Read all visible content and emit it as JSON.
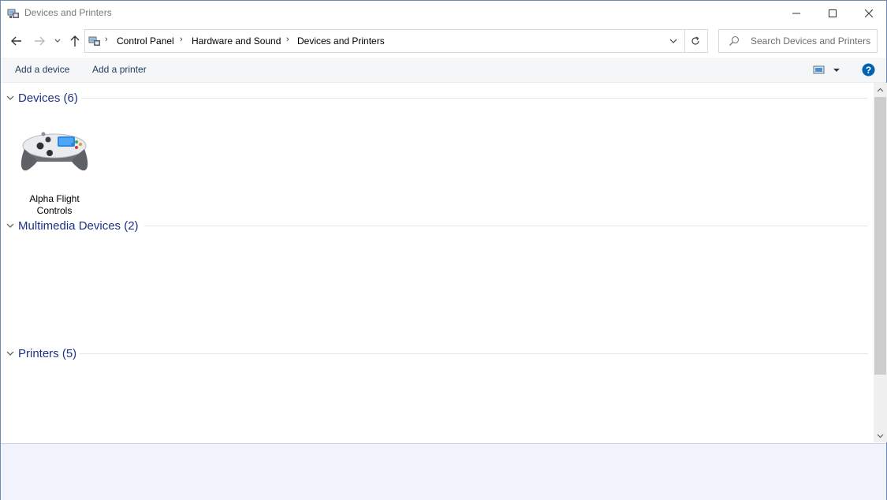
{
  "window": {
    "title": "Devices and Printers",
    "buttons": [
      "minimize",
      "maximize",
      "close"
    ]
  },
  "nav": {
    "breadcrumb": [
      "Control Panel",
      "Hardware and Sound",
      "Devices and Printers"
    ],
    "search_placeholder": "Search Devices and Printers"
  },
  "commands": {
    "add_device": "Add a device",
    "add_printer": "Add a printer"
  },
  "groups": [
    {
      "title": "Devices (6)",
      "items": [
        {
          "label_line1": "Alpha Flight",
          "label_line2": "Controls",
          "icon": "gamepad-icon"
        }
      ]
    },
    {
      "title": "Multimedia Devices (2)",
      "items": []
    },
    {
      "title": "Printers (5)",
      "items": []
    }
  ],
  "colors": {
    "group_header": "#1e3287",
    "command_text": "#1e395b",
    "help_blue": "#0063b1",
    "details_pane": "#f0f3fa"
  }
}
